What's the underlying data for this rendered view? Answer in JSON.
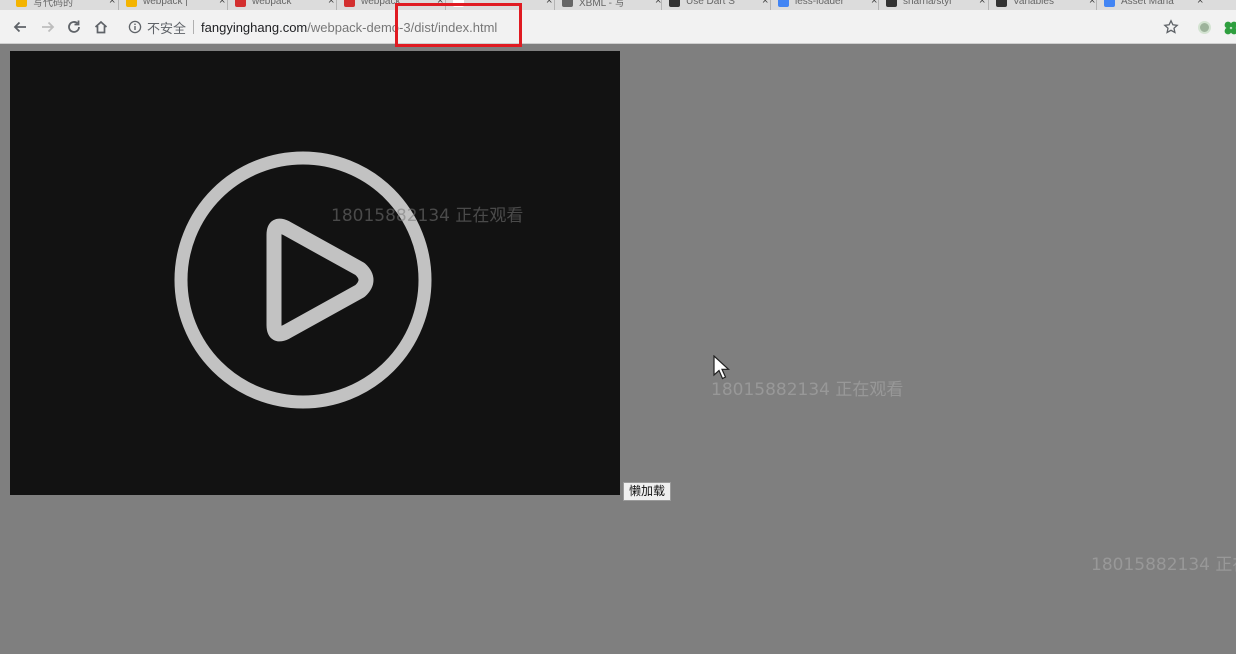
{
  "tabs": [
    {
      "title": "写代码的",
      "favicon_color": "#f4b400"
    },
    {
      "title": "webpack |",
      "favicon_color": "#f4b400"
    },
    {
      "title": "webpack",
      "favicon_color": "#d32f2f"
    },
    {
      "title": "webpack",
      "favicon_color": "#d32f2f"
    },
    {
      "title": "",
      "favicon_color": "#ffffff"
    },
    {
      "title": "XBML - 写",
      "favicon_color": "#666666"
    },
    {
      "title": "Use Dart S",
      "favicon_color": "#333333"
    },
    {
      "title": "less-loader",
      "favicon_color": "#4285f4"
    },
    {
      "title": "sharna/styl",
      "favicon_color": "#333333"
    },
    {
      "title": "Variables",
      "favicon_color": "#333333"
    },
    {
      "title": "Asset Mana",
      "favicon_color": "#4285f4"
    }
  ],
  "toolbar": {
    "security_label": "不安全",
    "url_host": "fangyinghang.com",
    "url_path": "/webpack-demo-3/dist/index.html"
  },
  "page": {
    "lazy_button_label": "懒加载",
    "watermark_text": "18015882134 正在观看"
  },
  "colors": {
    "page_background": "#7f7f7f",
    "video_background": "#121212",
    "play_icon": "#c2c2c2",
    "highlight": "#e01b22"
  },
  "icons": [
    "back-icon",
    "forward-icon",
    "reload-icon",
    "home-icon",
    "info-icon",
    "star-icon",
    "play-icon",
    "cursor-icon"
  ]
}
